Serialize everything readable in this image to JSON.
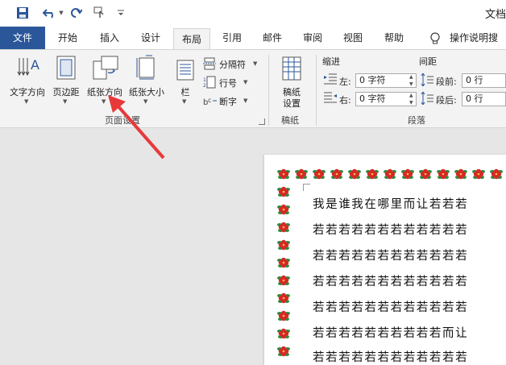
{
  "title": "文档",
  "quick_access": {
    "save_icon": "save-icon",
    "undo_icon": "undo-icon",
    "redo_icon": "redo-icon",
    "touch_icon": "touch-mode-icon",
    "customize_icon": "customize-icon"
  },
  "tabs": [
    "文件",
    "开始",
    "插入",
    "设计",
    "布局",
    "引用",
    "邮件",
    "审阅",
    "视图",
    "帮助"
  ],
  "active_tab": "布局",
  "tell_me": "操作说明搜",
  "page_setup": {
    "text_direction": "文字方向",
    "margins": "页边距",
    "orientation": "纸张方向",
    "size": "纸张大小",
    "columns": "栏",
    "breaks": "分隔符",
    "line_numbers": "行号",
    "hyphenation": "断字",
    "group_label": "页面设置"
  },
  "manuscript": {
    "button": "稿纸\n设置",
    "group_label": "稿纸"
  },
  "paragraph": {
    "indent_header": "缩进",
    "spacing_header": "间距",
    "left_label": "左:",
    "left_value": "0 字符",
    "right_label": "右:",
    "right_value": "0 字符",
    "before_label": "段前:",
    "before_value": "0 行",
    "after_label": "段后:",
    "after_value": "0 行",
    "group_label": "段落"
  },
  "document": {
    "lines": [
      "我是谁我在哪里而让若若若",
      "若若若若若若若若若若若若",
      "若若若若若若若若若若若若",
      "若若若若若若若若若若若若",
      "若若若若若若若若若若若若",
      "若若若若若若若若若若而让",
      "若若若若若若若若若若若若"
    ]
  },
  "colors": {
    "accent": "#2b579a",
    "annotation_arrow": "#e8393a",
    "border_flower": "#d62828",
    "border_leaf": "#2e8b3a"
  }
}
